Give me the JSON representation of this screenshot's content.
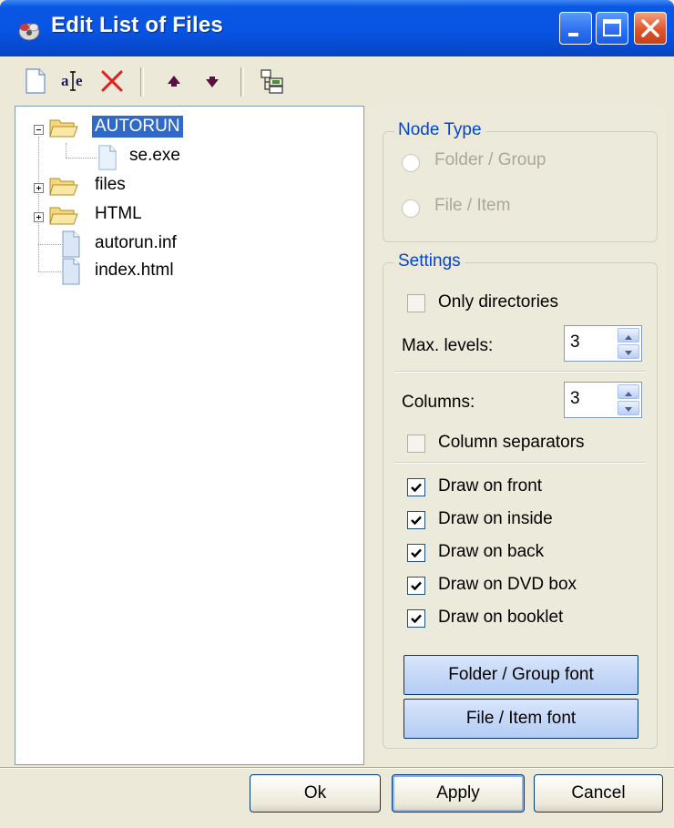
{
  "window": {
    "title": "Edit List of Files"
  },
  "tree": {
    "nodes": [
      {
        "label": "AUTORUN",
        "type": "folder",
        "expanded": true,
        "selected": true
      },
      {
        "label": "se.exe",
        "type": "file"
      },
      {
        "label": "files",
        "type": "folder",
        "expanded": false
      },
      {
        "label": "HTML",
        "type": "folder",
        "expanded": false
      },
      {
        "label": "autorun.inf",
        "type": "file"
      },
      {
        "label": "index.html",
        "type": "file"
      }
    ]
  },
  "node_type": {
    "title": "Node Type",
    "options": [
      "Folder / Group",
      "File / Item"
    ]
  },
  "settings": {
    "title": "Settings",
    "only_directories": "Only directories",
    "max_levels_label": "Max. levels:",
    "max_levels_value": "3",
    "columns_label": "Columns:",
    "columns_value": "3",
    "column_separators": "Column separators",
    "draw_options": [
      {
        "label": "Draw on front",
        "checked": true
      },
      {
        "label": "Draw on inside",
        "checked": true
      },
      {
        "label": "Draw on back",
        "checked": true
      },
      {
        "label": "Draw on DVD box",
        "checked": true
      },
      {
        "label": "Draw on booklet",
        "checked": true
      }
    ],
    "folder_font_button": "Folder / Group font",
    "file_font_button": "File / Item font"
  },
  "buttons": {
    "ok": "Ok",
    "apply": "Apply",
    "cancel": "Cancel"
  },
  "colors": {
    "title_bar": "#0854e3",
    "selection": "#316ac5",
    "group_title": "#0046d5"
  }
}
